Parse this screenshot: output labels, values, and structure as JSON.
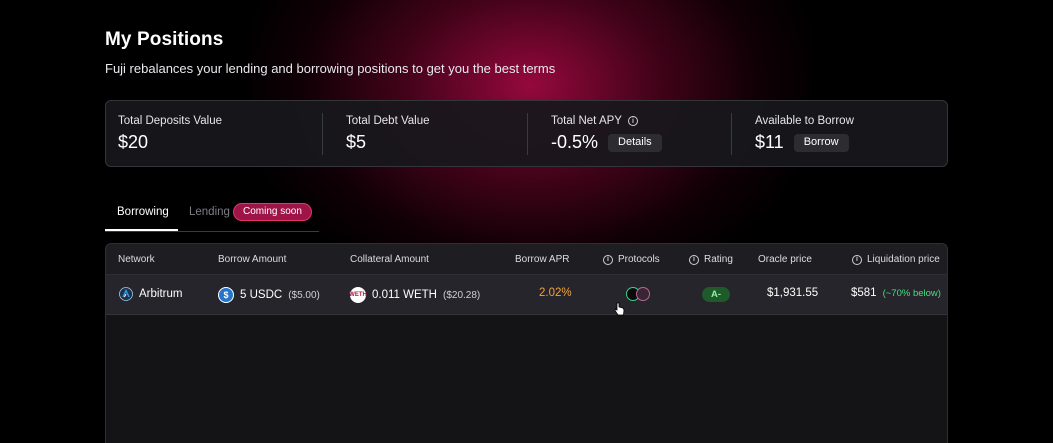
{
  "header": {
    "title": "My Positions",
    "subtitle": "Fuji rebalances your lending and borrowing positions to get you the best terms"
  },
  "stats": {
    "deposits": {
      "label": "Total Deposits Value",
      "value": "$20"
    },
    "debt": {
      "label": "Total Debt Value",
      "value": "$5"
    },
    "net_apy": {
      "label": "Total Net APY",
      "value": "-0.5%",
      "button": "Details"
    },
    "available": {
      "label": "Available to Borrow",
      "value": "$11",
      "button": "Borrow"
    }
  },
  "tabs": {
    "borrowing": "Borrowing",
    "lending": "Lending",
    "lending_badge": "Coming soon"
  },
  "table": {
    "headers": {
      "network": "Network",
      "borrow_amount": "Borrow Amount",
      "collateral_amount": "Collateral Amount",
      "borrow_apr": "Borrow APR",
      "protocols": "Protocols",
      "rating": "Rating",
      "oracle_price": "Oracle price",
      "liquidation_price": "Liquidation price"
    },
    "rows": [
      {
        "network": "Arbitrum",
        "borrow_amount": "5 USDC",
        "borrow_usd": "($5.00)",
        "collateral_amount": "0.011 WETH",
        "collateral_usd": "($20.28)",
        "borrow_apr": "2.02%",
        "protocol_icons": [
          "protocol-icon-green",
          "protocol-icon-pink"
        ],
        "rating": "A-",
        "oracle_price": "$1,931.55",
        "liquidation_price": "$581",
        "liquidation_note": "(~70% below)"
      }
    ]
  },
  "colors": {
    "accent": "#9e1446",
    "apr": "#f3a33b",
    "positive": "#4ade80"
  }
}
